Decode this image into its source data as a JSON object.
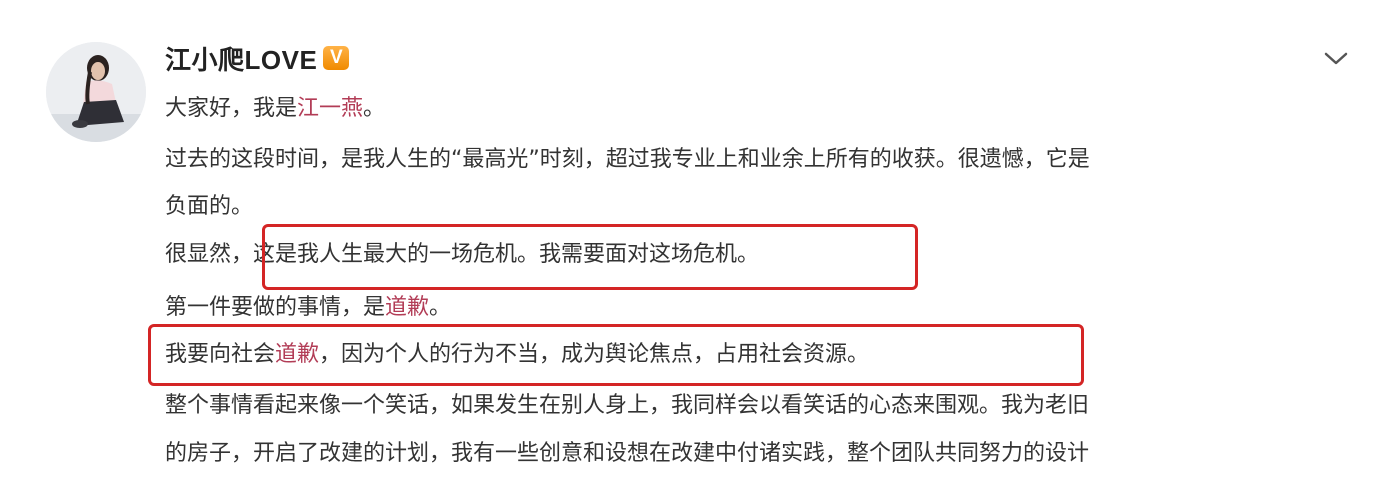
{
  "post": {
    "username": "江小爬LOVE",
    "badge": "V",
    "lines": [
      {
        "text": "大家好，我是",
        "highlight": "江一燕",
        "after": "。"
      },
      {
        "text": "过去的这段时间，是我人生的“最高光”时刻，超过我专业上和业余上所有的收获。很遗憾，它是"
      },
      {
        "text": "负面的。"
      },
      {
        "text": "很显然，这是我人生最大的一场危机。我需要面对这场危机。"
      },
      {
        "text": "第一件要做的事情，是",
        "highlight": "道歉",
        "after": "。"
      },
      {
        "text": "我要向社会",
        "highlight": "道歉",
        "after": "，因为个人的行为不当，成为舆论焦点，占用社会资源。"
      },
      {
        "text": "整个事情看起来像一个笑话，如果发生在别人身上，我同样会以看笑话的心态来围观。我为老旧"
      },
      {
        "text": "的房子，开启了改建的计划，我有一些创意和设想在改建中付诸实践，整个团队共同努力的设计"
      }
    ]
  },
  "icons": {
    "avatar": "avatar-photo",
    "badge": "vip-badge-icon",
    "menu": "chevron-down-icon"
  },
  "colors": {
    "highlight": "#b23c56",
    "box": "#d42525",
    "badge": "#f08a00",
    "text": "#333333"
  }
}
